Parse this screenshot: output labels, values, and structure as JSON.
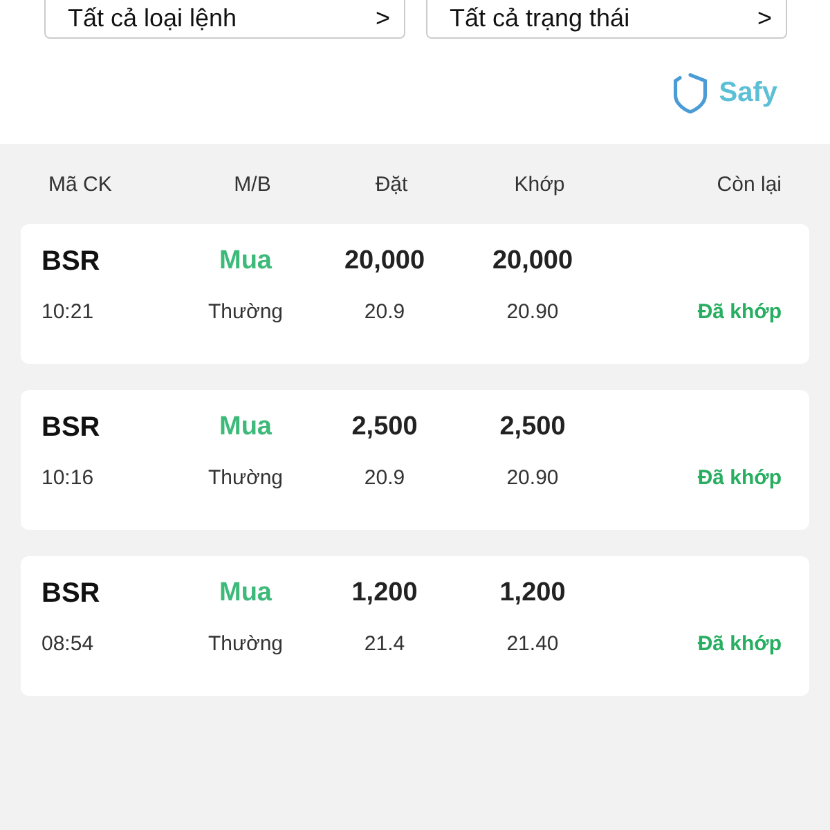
{
  "filters": [
    {
      "label": "Tất cả loại lệnh",
      "chevron": ">"
    },
    {
      "label": "Tất cả trạng thái",
      "chevron": ">"
    }
  ],
  "brand": {
    "name": "Safy"
  },
  "table": {
    "columns": [
      "Mã CK",
      "M/B",
      "Đặt",
      "Khớp",
      "Còn lại"
    ],
    "rows": [
      {
        "symbol": "BSR",
        "time": "10:21",
        "side": {
          "text": "Mua",
          "color": "#3dba7a"
        },
        "order_type": "Thường",
        "qty": "20,000",
        "price": "20.9",
        "matched_qty": "20,000",
        "matched_price": "20.90",
        "status": {
          "text": "Đã khớp",
          "color": "#27ae60"
        }
      },
      {
        "symbol": "BSR",
        "time": "10:16",
        "side": {
          "text": "Mua",
          "color": "#3dba7a"
        },
        "order_type": "Thường",
        "qty": "2,500",
        "price": "20.9",
        "matched_qty": "2,500",
        "matched_price": "20.90",
        "status": {
          "text": "Đã khớp",
          "color": "#27ae60"
        }
      },
      {
        "symbol": "BSR",
        "time": "08:54",
        "side": {
          "text": "Mua",
          "color": "#3dba7a"
        },
        "order_type": "Thường",
        "qty": "1,200",
        "price": "21.4",
        "matched_qty": "1,200",
        "matched_price": "21.40",
        "status": {
          "text": "Đã khớp",
          "color": "#27ae60"
        }
      }
    ]
  }
}
